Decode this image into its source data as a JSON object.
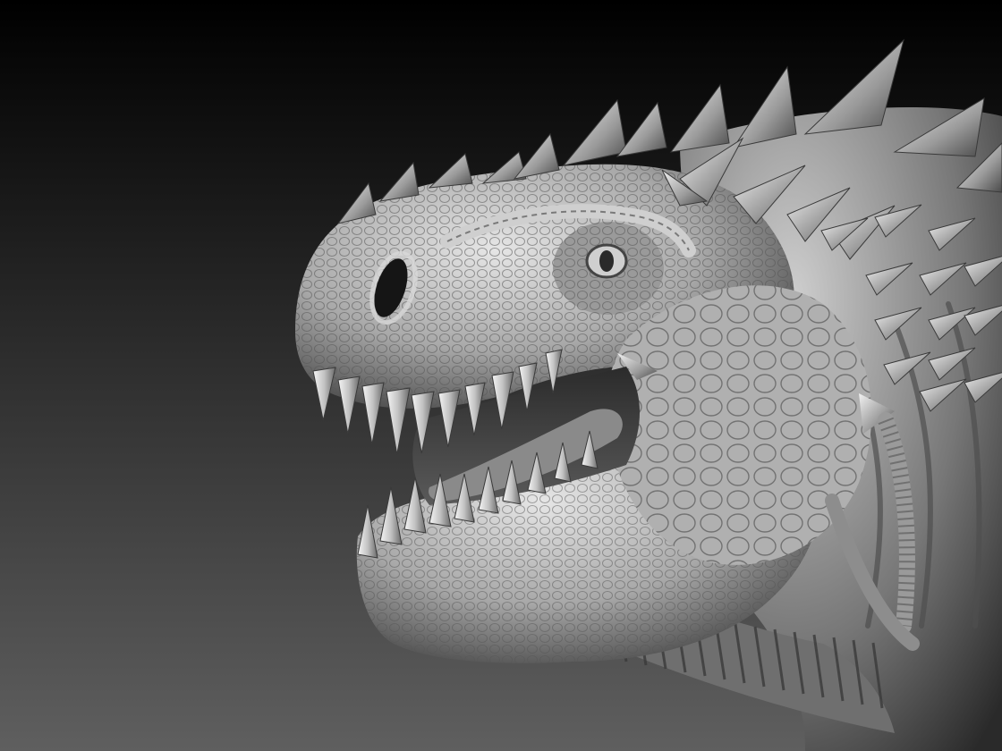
{
  "scene": {
    "subject": "dinosaur-head-sculpt-render",
    "background_gradient": [
      "#000000",
      "#5f5f5f"
    ],
    "skin_colors": {
      "highlight": "#e6e6e6",
      "light": "#bdbdbd",
      "mid": "#8c8c8c",
      "shadow": "#3c3c3c",
      "deep": "#1e1e1e"
    }
  }
}
